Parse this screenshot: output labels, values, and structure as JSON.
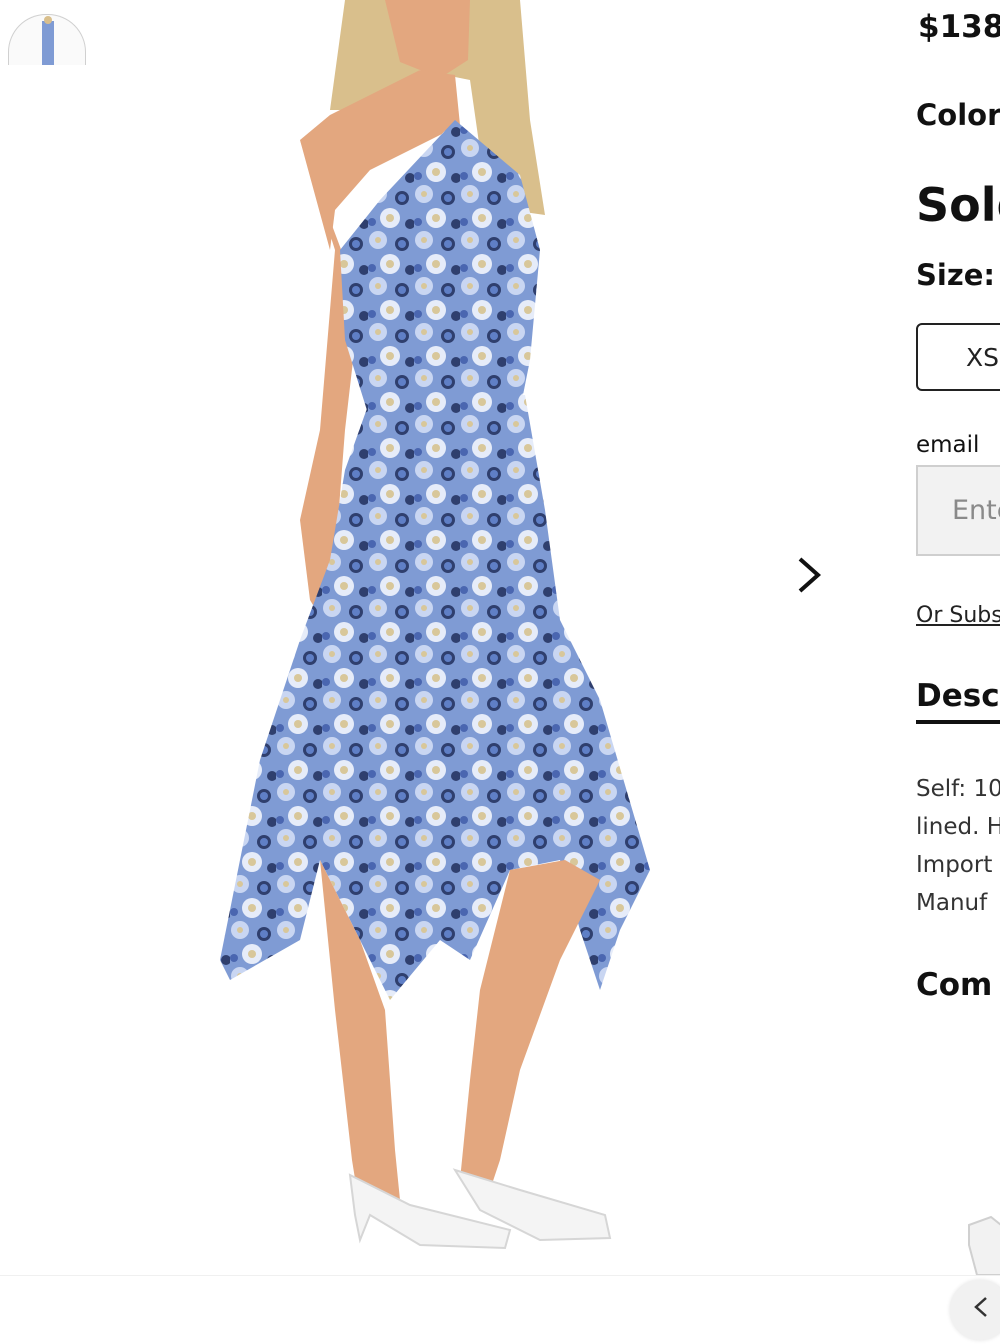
{
  "product": {
    "price": "$138",
    "color_label": "Color",
    "sold_label": "Sold",
    "size_label": "Size:",
    "size_option": "XS",
    "email_label": "email",
    "email_placeholder": "Enter",
    "subscribe_link": "Or Subscribe",
    "description_tab": "Description",
    "description_lines": [
      "Self: 10",
      "lined. H",
      "Import",
      "Manuf"
    ],
    "composition_label": "Com"
  },
  "colors": {
    "dress_base": "#7f9bd4",
    "dress_dark": "#2f3f6e",
    "dress_light": "#c9d6f2",
    "dress_yellow": "#d8c79a",
    "skin": "#e3a77f",
    "hair": "#d9bf8c",
    "shoe": "#f4f4f4"
  },
  "icons": {
    "next": "chevron-right-icon",
    "prev": "chevron-left-icon"
  }
}
